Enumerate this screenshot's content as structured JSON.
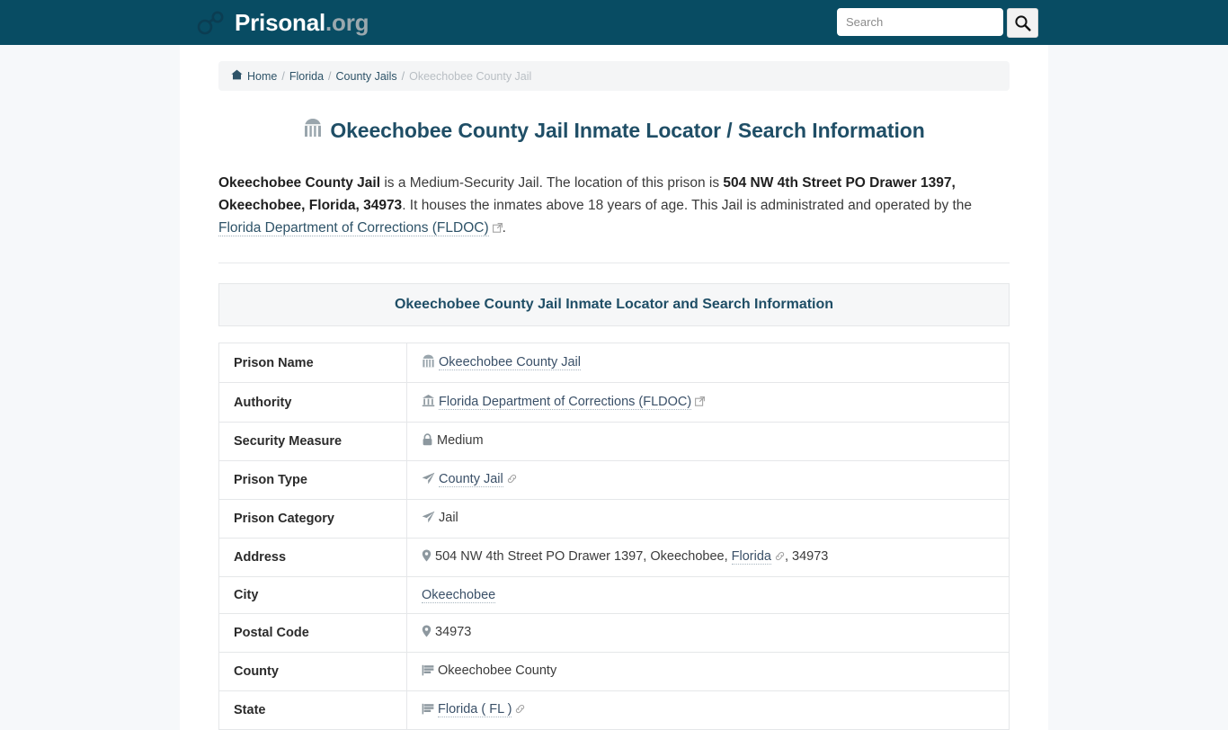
{
  "header": {
    "brand_name": "Prisonal",
    "brand_tld": ".org",
    "brand_icon": "handcuffs-icon",
    "search_placeholder": "Search",
    "search_value": "",
    "search_button_icon": "search-icon",
    "background_color": "#084c63"
  },
  "breadcrumb": {
    "home_icon": "home-icon",
    "items": [
      {
        "label": "Home",
        "link": true
      },
      {
        "label": "Florida",
        "link": true
      },
      {
        "label": "County Jails",
        "link": true
      },
      {
        "label": "Okeechobee County Jail",
        "link": false
      }
    ],
    "separator": "/"
  },
  "main": {
    "title_icon": "landmark-jail-icon",
    "title": "Okeechobee County Jail Inmate Locator / Search Information",
    "intro": {
      "b1": "Okeechobee County Jail",
      "t1": " is a Medium-Security Jail. The location of this prison is ",
      "b2": "504 NW 4th Street PO Drawer 1397, Okeechobee, Florida, 34973",
      "t2": ". It houses the inmates above 18 years of age. This Jail is administrated and operated by the ",
      "link": "Florida Department of Corrections (FLDOC)",
      "link_icon": "external-link-icon",
      "t3": "."
    },
    "table_caption": "Okeechobee County Jail Inmate Locator and Search Information",
    "rows": [
      {
        "key": "Prison Name",
        "icon": "landmark-jail-icon",
        "value": "Okeechobee County Jail",
        "link": true,
        "trailing_icon": ""
      },
      {
        "key": "Authority",
        "icon": "bank-icon",
        "value": "Florida Department of Corrections (FLDOC)",
        "link": true,
        "trailing_icon": "external-link-icon"
      },
      {
        "key": "Security Measure",
        "icon": "lock-icon",
        "value": "Medium",
        "link": false,
        "trailing_icon": ""
      },
      {
        "key": "Prison Type",
        "icon": "paper-plane-icon",
        "value": "County Jail",
        "link": true,
        "trailing_icon": "link-icon"
      },
      {
        "key": "Prison Category",
        "icon": "paper-plane-icon",
        "value": "Jail",
        "link": false,
        "trailing_icon": ""
      },
      {
        "key": "Address",
        "icon": "map-pin-icon",
        "value": "504 NW 4th Street PO Drawer 1397, Okeechobee, ",
        "link": false,
        "inline_link": "Florida",
        "inline_link_icon": "link-icon",
        "value_tail": ", 34973",
        "trailing_icon": ""
      },
      {
        "key": "City",
        "icon": "",
        "value": "Okeechobee",
        "link": true,
        "trailing_icon": ""
      },
      {
        "key": "Postal Code",
        "icon": "map-pin-icon",
        "value": "34973",
        "link": false,
        "trailing_icon": ""
      },
      {
        "key": "County",
        "icon": "flag-icon",
        "value": "Okeechobee County",
        "link": false,
        "trailing_icon": ""
      },
      {
        "key": "State",
        "icon": "flag-icon",
        "value": "Florida ( FL )",
        "link": true,
        "trailing_icon": "link-icon"
      }
    ]
  },
  "colors": {
    "header_bg": "#084c63",
    "page_bg": "#f6f8fa",
    "title": "#1f4e66",
    "link": "#3a5068"
  }
}
